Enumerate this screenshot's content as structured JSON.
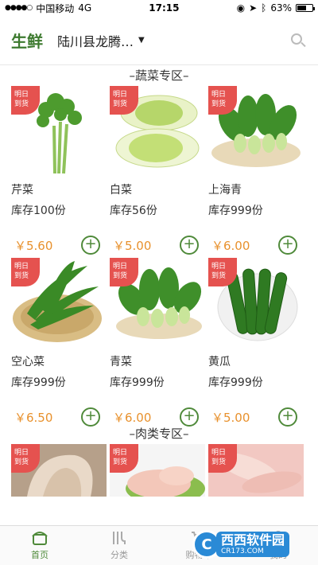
{
  "status_bar": {
    "carrier": "中国移动",
    "network": "4G",
    "time": "17:15",
    "battery": "63%"
  },
  "header": {
    "title": "生鲜",
    "location": "陆川县龙腾…"
  },
  "sections": {
    "vegetables": "–蔬菜专区–",
    "meat": "–肉类专区–"
  },
  "badge_text": [
    "明日",
    "到货"
  ],
  "products": [
    {
      "name": "芹菜",
      "stock": "库存100份",
      "price": "￥5.60",
      "image": "celery"
    },
    {
      "name": "白菜",
      "stock": "库存56份",
      "price": "￥5.00",
      "image": "napa-cabbage"
    },
    {
      "name": "上海青",
      "stock": "库存999份",
      "price": "￥6.00",
      "image": "bok-choy"
    },
    {
      "name": "空心菜",
      "stock": "库存999份",
      "price": "￥6.50",
      "image": "water-spinach"
    },
    {
      "name": "青菜",
      "stock": "库存999份",
      "price": "￥6.00",
      "image": "bok-choy"
    },
    {
      "name": "黄瓜",
      "stock": "库存999份",
      "price": "￥5.00",
      "image": "cucumber"
    }
  ],
  "meat_items": [
    {
      "image": "duck"
    },
    {
      "image": "chicken"
    },
    {
      "image": "pig-trotters"
    }
  ],
  "tabs": [
    {
      "label": "首页",
      "icon": "home-icon",
      "active": true
    },
    {
      "label": "分类",
      "icon": "category-icon",
      "active": false
    },
    {
      "label": "购物车",
      "icon": "cart-icon",
      "active": false
    },
    {
      "label": "我的",
      "icon": "user-icon",
      "active": false
    }
  ],
  "watermark": {
    "logo": "C",
    "text": "西西软件园",
    "sub": "CR173.COM"
  },
  "colors": {
    "brand_green": "#3d7a2f",
    "price_orange": "#e8912d",
    "badge_red": "#e5524f",
    "active_tab": "#4f8a3a"
  }
}
